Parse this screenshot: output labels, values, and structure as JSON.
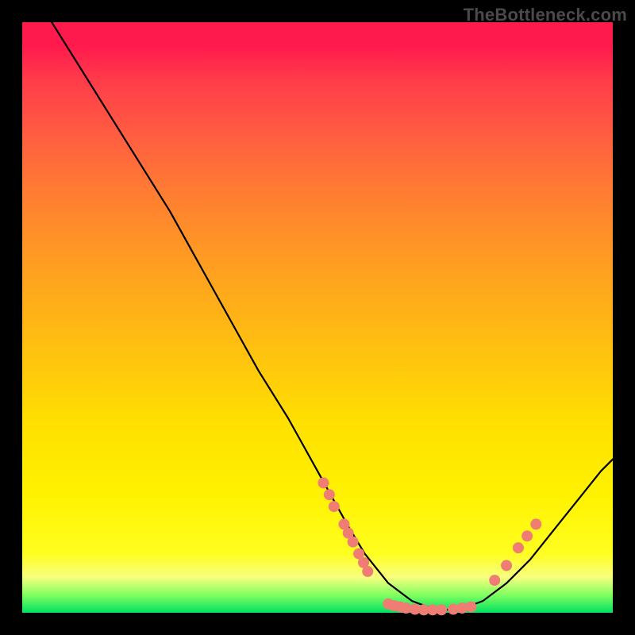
{
  "watermark": "TheBottleneck.com",
  "colors": {
    "gradient_top": "#ff1a4d",
    "gradient_mid_yellow": "#fff200",
    "gradient_bottom_green": "#00e060",
    "curve": "#000000",
    "dot": "#ef7d73",
    "frame": "#000000"
  },
  "chart_data": {
    "type": "line",
    "title": "",
    "xlabel": "",
    "ylabel": "",
    "xlim": [
      0,
      100
    ],
    "ylim": [
      0,
      100
    ],
    "curve": {
      "x": [
        5,
        10,
        15,
        20,
        25,
        30,
        35,
        40,
        45,
        50,
        55,
        58,
        62,
        66,
        70,
        74,
        78,
        82,
        86,
        90,
        94,
        98,
        100
      ],
      "y": [
        100,
        92,
        84,
        76,
        68,
        59,
        50,
        41,
        33,
        24,
        15,
        10,
        5,
        2,
        0.5,
        0.5,
        2,
        5,
        9,
        14,
        19,
        24,
        26
      ]
    },
    "series": [
      {
        "name": "left-cluster-dots",
        "points": [
          {
            "x": 51,
            "y": 22
          },
          {
            "x": 52,
            "y": 20
          },
          {
            "x": 52.8,
            "y": 18
          },
          {
            "x": 54.5,
            "y": 15
          },
          {
            "x": 55.2,
            "y": 13.5
          },
          {
            "x": 56,
            "y": 12
          },
          {
            "x": 57,
            "y": 10
          },
          {
            "x": 57.8,
            "y": 8.5
          },
          {
            "x": 58.5,
            "y": 7
          }
        ]
      },
      {
        "name": "bottom-cluster-dots",
        "points": [
          {
            "x": 62,
            "y": 1.5
          },
          {
            "x": 63,
            "y": 1.2
          },
          {
            "x": 64,
            "y": 1.0
          },
          {
            "x": 65,
            "y": 0.8
          },
          {
            "x": 66.5,
            "y": 0.6
          },
          {
            "x": 68,
            "y": 0.5
          },
          {
            "x": 69.5,
            "y": 0.5
          },
          {
            "x": 71,
            "y": 0.5
          },
          {
            "x": 73,
            "y": 0.6
          },
          {
            "x": 74.5,
            "y": 0.8
          },
          {
            "x": 76,
            "y": 1.0
          }
        ]
      },
      {
        "name": "right-arm-dots",
        "points": [
          {
            "x": 80,
            "y": 5.5
          },
          {
            "x": 82,
            "y": 8
          },
          {
            "x": 84,
            "y": 11
          },
          {
            "x": 85.5,
            "y": 13
          },
          {
            "x": 87,
            "y": 15
          }
        ]
      }
    ]
  }
}
